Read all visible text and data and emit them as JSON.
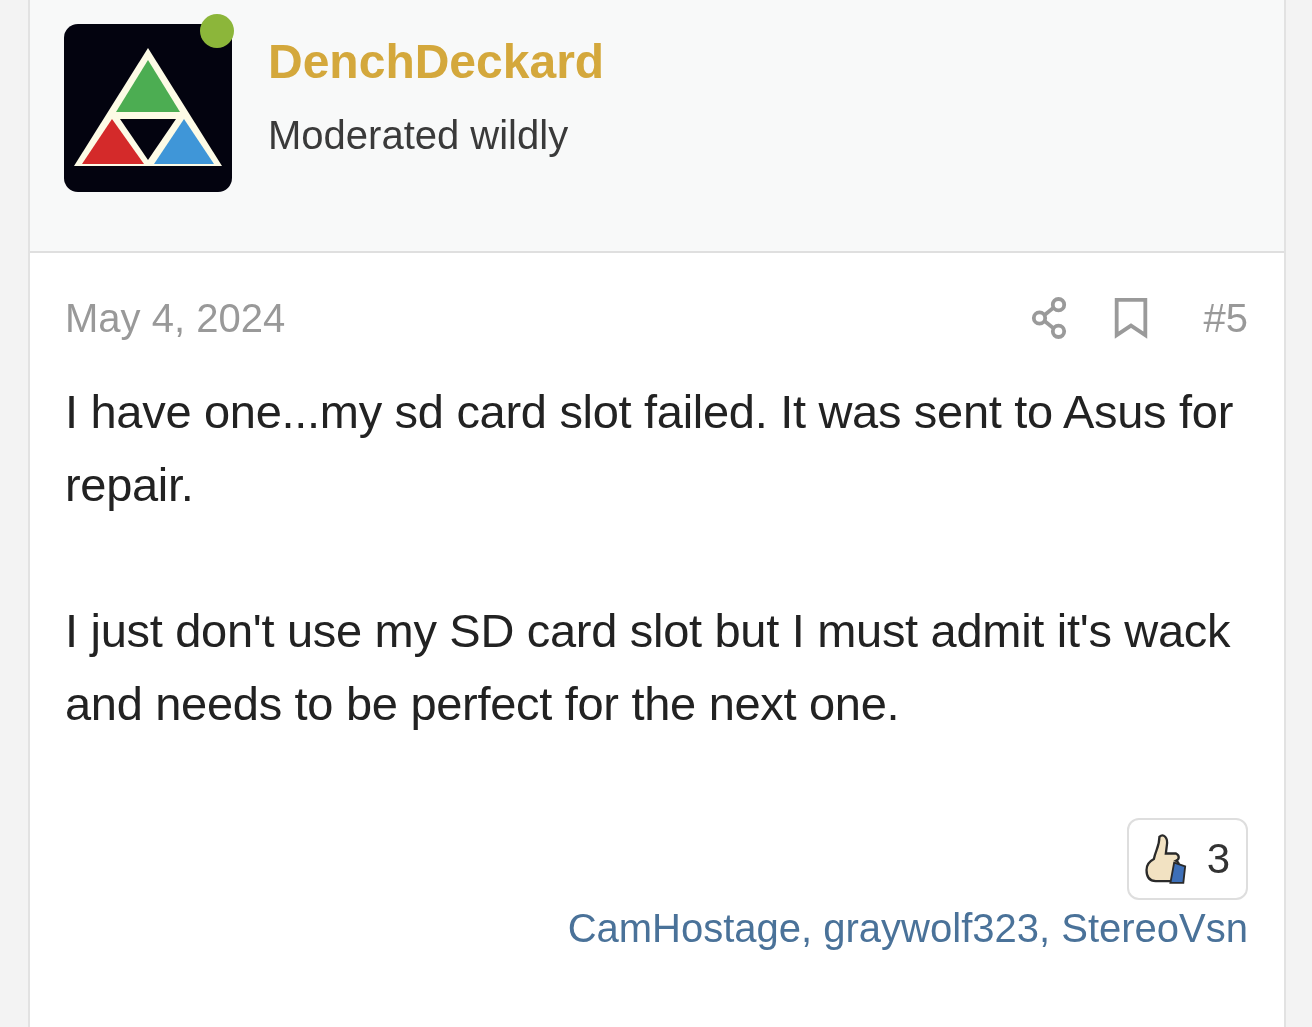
{
  "author": {
    "name": "DenchDeckard",
    "title": "Moderated wildly",
    "online": true
  },
  "post": {
    "date": "May 4, 2024",
    "number": "#5",
    "paragraphs": [
      "I have one...my sd card slot failed. It was sent to Asus for repair.",
      "I just don't use my SD card slot but I must admit it's wack and needs to be perfect for the next one."
    ]
  },
  "reactions": {
    "count": "3",
    "users": "CamHostage, graywolf323, StereoVsn"
  }
}
